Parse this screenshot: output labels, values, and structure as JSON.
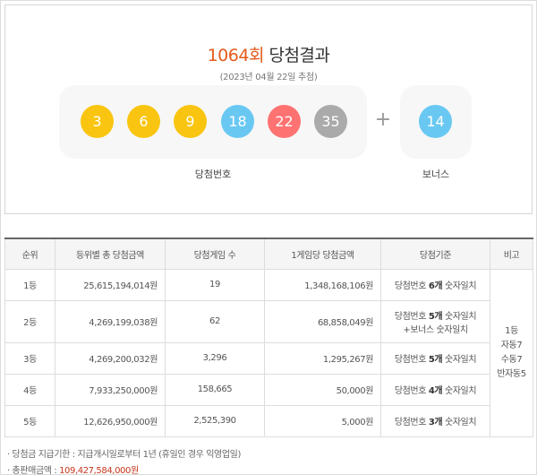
{
  "result": {
    "round": "1064회",
    "suffix": " 당첨결과",
    "draw_date": "(2023년 04월 22일 추첨)",
    "winning_numbers": [
      {
        "value": "3",
        "color": "#f9c510"
      },
      {
        "value": "6",
        "color": "#f9c510"
      },
      {
        "value": "9",
        "color": "#f9c510"
      },
      {
        "value": "18",
        "color": "#69c8f2"
      },
      {
        "value": "22",
        "color": "#ff7272"
      },
      {
        "value": "35",
        "color": "#aaaaaa"
      }
    ],
    "plus": "+",
    "bonus_number": {
      "value": "14",
      "color": "#69c8f2"
    },
    "winning_label": "당첨번호",
    "bonus_label": "보너스"
  },
  "table": {
    "headers": [
      "순위",
      "등위별 총 당첨금액",
      "당첨게임 수",
      "1게임당 당첨금액",
      "당첨기준",
      "비고"
    ],
    "rows": [
      {
        "rank": "1등",
        "total": "25,615,194,014원",
        "games": "19",
        "per_game": "1,348,168,106원",
        "criteria_a": "당첨번호 ",
        "criteria_b": "6개",
        "criteria_c": " 숫자일치",
        "criteria_d": ""
      },
      {
        "rank": "2등",
        "total": "4,269,199,038원",
        "games": "62",
        "per_game": "68,858,049원",
        "criteria_a": "당첨번호 ",
        "criteria_b": "5개",
        "criteria_c": " 숫자일치",
        "criteria_d": "+보너스 숫자일치"
      },
      {
        "rank": "3등",
        "total": "4,269,200,032원",
        "games": "3,296",
        "per_game": "1,295,267원",
        "criteria_a": "당첨번호 ",
        "criteria_b": "5개",
        "criteria_c": " 숫자일치",
        "criteria_d": ""
      },
      {
        "rank": "4등",
        "total": "7,933,250,000원",
        "games": "158,665",
        "per_game": "50,000원",
        "criteria_a": "당첨번호 ",
        "criteria_b": "4개",
        "criteria_c": " 숫자일치",
        "criteria_d": ""
      },
      {
        "rank": "5등",
        "total": "12,626,950,000원",
        "games": "2,525,390",
        "per_game": "5,000원",
        "criteria_a": "당첨번호 ",
        "criteria_b": "3개",
        "criteria_c": " 숫자일치",
        "criteria_d": ""
      }
    ],
    "note_lines": [
      "1등",
      "자동7",
      "수동7",
      "반자동5"
    ]
  },
  "footer": {
    "claim_period": "· 당첨금 지급기한 : 지급개시일로부터 1년 (휴일인 경우 익영업일)",
    "sales_label": "· 총판매금액 : ",
    "sales_value": "109,427,584,000원"
  }
}
